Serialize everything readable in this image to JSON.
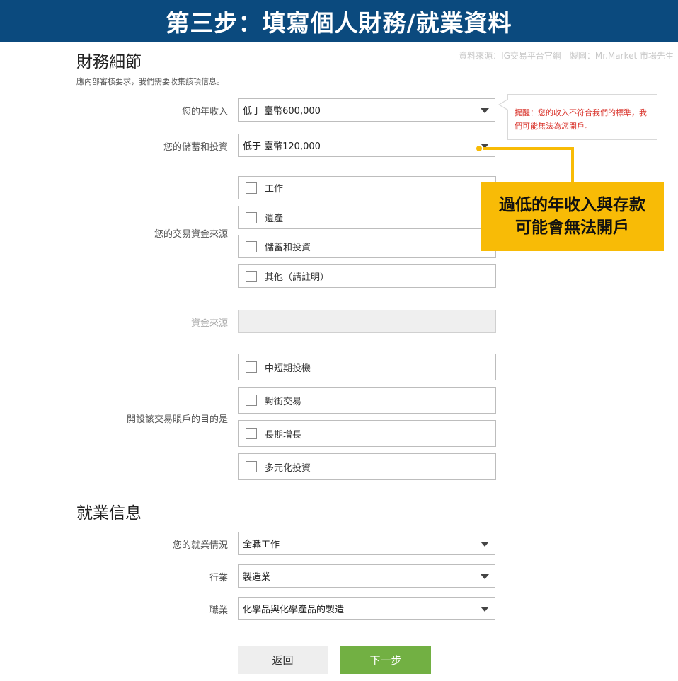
{
  "banner": {
    "title": "第三步：填寫個人財務/就業資料"
  },
  "source_note": "資料來源：IG交易平台官網　製圖：Mr.Market 市場先生",
  "finance": {
    "title": "財務細節",
    "subtitle": "應內部審核要求，我們需要收集該項信息。",
    "income": {
      "label": "您的年收入",
      "value": "低于 臺幣600,000"
    },
    "savings": {
      "label": "您的儲蓄和投資",
      "value": "低于 臺幣120,000"
    },
    "fund_source": {
      "label": "您的交易資金來源",
      "options": [
        "工作",
        "遺產",
        "儲蓄和投資",
        "其他（請註明）"
      ]
    },
    "fund_source_detail": {
      "label": "資金來源",
      "value": ""
    },
    "purpose": {
      "label": "開設該交易賬戶的目的是",
      "options": [
        "中短期投機",
        "對衝交易",
        "長期增長",
        "多元化投資"
      ]
    }
  },
  "warning": {
    "text": "提醒：您的收入不符合我們的標準，我們可能無法為您開戶。",
    "color": "#d9332b"
  },
  "callout": {
    "line1": "過低的年收入與存款",
    "line2": "可能會無法開戶",
    "color": "#f8bb06"
  },
  "employment": {
    "title": "就業信息",
    "status": {
      "label": "您的就業情況",
      "value": "全職工作"
    },
    "industry": {
      "label": "行業",
      "value": "製造業"
    },
    "occupation": {
      "label": "職業",
      "value": "化學品與化學產品的製造"
    }
  },
  "buttons": {
    "back": "返回",
    "next": "下一步"
  },
  "colors": {
    "banner": "#0b4a7e",
    "next_button": "#72b043"
  }
}
